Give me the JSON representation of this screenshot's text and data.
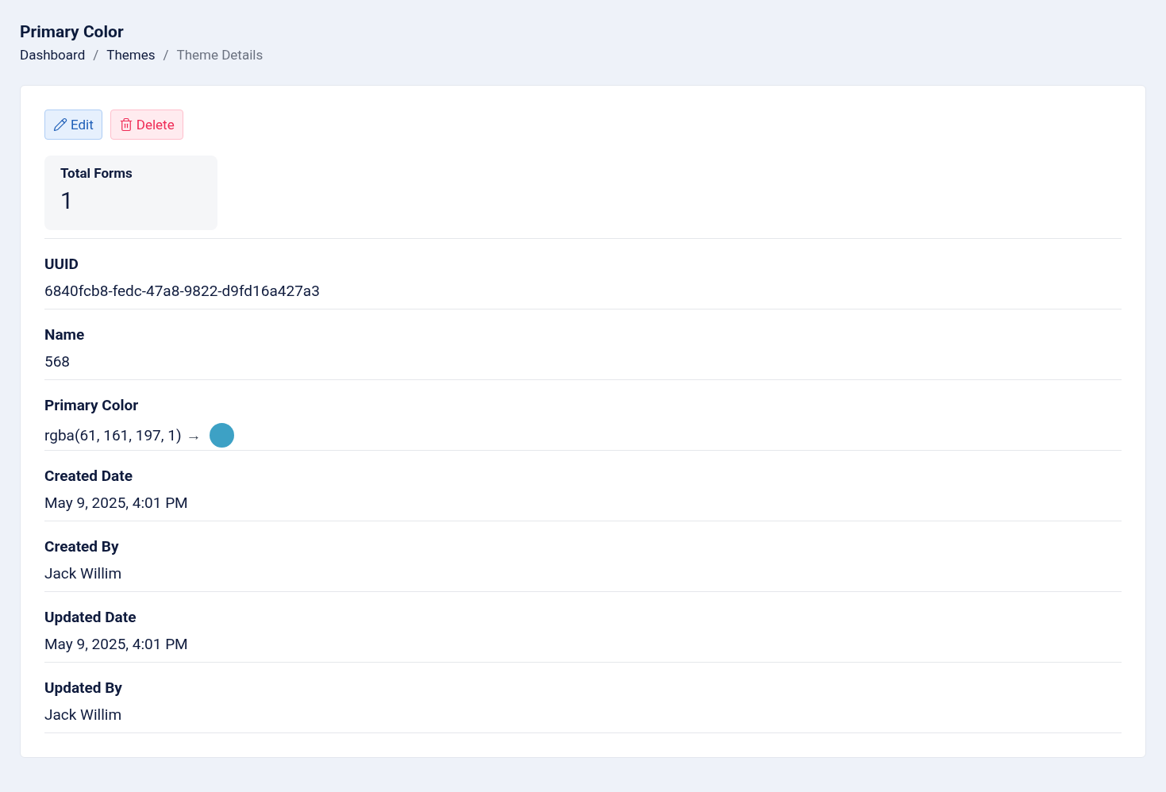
{
  "page_title": "Primary Color",
  "breadcrumb": [
    {
      "label": "Dashboard",
      "current": false
    },
    {
      "label": "Themes",
      "current": false
    },
    {
      "label": "Theme Details",
      "current": true
    }
  ],
  "breadcrumb_separator": "/",
  "actions": [
    {
      "kind": "edit",
      "label": "Edit"
    },
    {
      "kind": "delete",
      "label": "Delete"
    }
  ],
  "stat": {
    "label": "Total Forms",
    "value": "1"
  },
  "fields": [
    {
      "kind": "text",
      "label": "UUID",
      "value": "6840fcb8-fedc-47a8-9822-d9fd16a427a3"
    },
    {
      "kind": "text",
      "label": "Name",
      "value": "568"
    },
    {
      "kind": "color",
      "label": "Primary Color",
      "value": "rgba(61, 161, 197, 1)",
      "arrow": "→",
      "color": "#3da1c5"
    },
    {
      "kind": "text",
      "label": "Created Date",
      "value": "May 9, 2025, 4:01 PM"
    },
    {
      "kind": "text",
      "label": "Created By",
      "value": "Jack Willim"
    },
    {
      "kind": "text",
      "label": "Updated Date",
      "value": "May 9, 2025, 4:01 PM"
    },
    {
      "kind": "text",
      "label": "Updated By",
      "value": "Jack Willim"
    }
  ]
}
